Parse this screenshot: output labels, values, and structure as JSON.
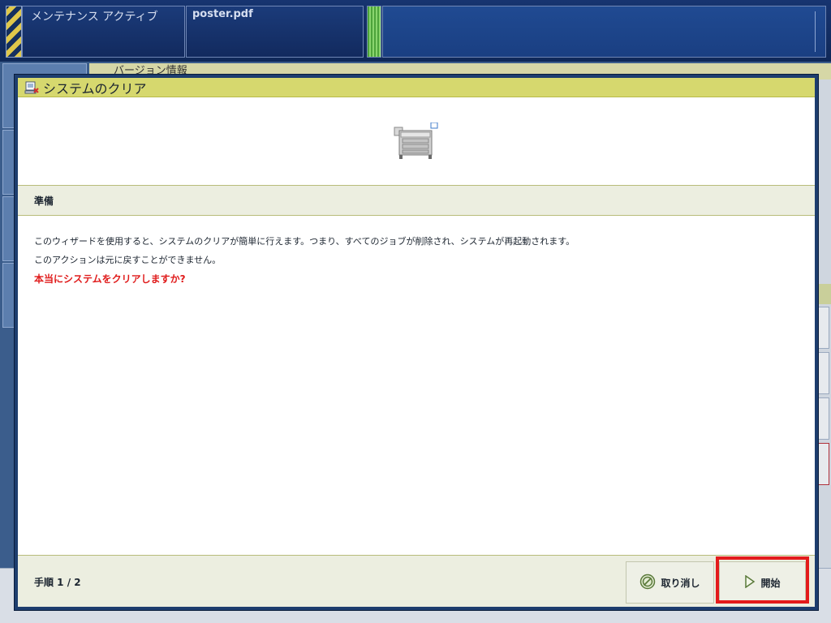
{
  "status_bar": {
    "mode_text": "メンテナンス アクティブ",
    "job_name": "poster.pdf"
  },
  "background": {
    "panel_header": "バージョン情報"
  },
  "dialog": {
    "title": "システムのクリア",
    "title_icon": "system-clear-icon",
    "image_icon": "printer-icon",
    "section_title": "準備",
    "body_lines": [
      "このウィザードを使用すると、システムのクリアが簡単に行えます。つまり、すべてのジョブが削除され、システムが再起動されます。",
      "このアクションは元に戻すことができません。"
    ],
    "warning": "本当にシステムをクリアしますか?",
    "step": "手順 1 / 2",
    "buttons": {
      "cancel": "取り消し",
      "start": "開始"
    }
  },
  "colors": {
    "dialog_titlebar": "#d6d86e",
    "warning": "#e01b1b",
    "highlight": "#e31b1b"
  }
}
